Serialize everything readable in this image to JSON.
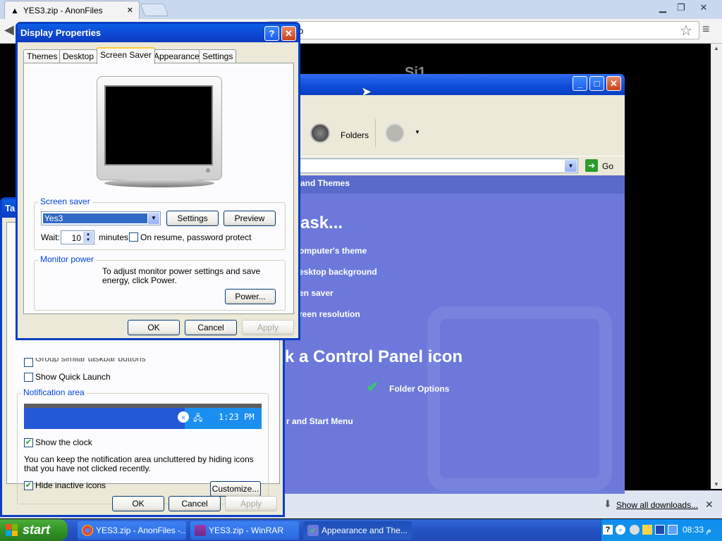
{
  "browser": {
    "tab_title": "YES3.zip - AnonFiles",
    "tab_close": "✕",
    "omnibox_fragment": "o",
    "page_hint": "Si1",
    "downloads": {
      "show_all": "Show all downloads..."
    }
  },
  "control_panel": {
    "toolbar": {
      "folders_label": "Folders"
    },
    "address": {
      "go_label": "Go"
    },
    "category_strip": "and Themes",
    "pick_task": "ask...",
    "tasks": [
      "omputer's theme",
      "esktop background",
      "en saver",
      "reen resolution"
    ],
    "pick_icon": "k a Control Panel icon",
    "icon_item": "Folder Options",
    "footer_link": "r and Start Menu"
  },
  "taskbar_props": {
    "tab_fragment": "Ta",
    "cut_checkbox": "Group similar taskbar buttons",
    "show_quick_launch": "Show Quick Launch",
    "notification_area": {
      "label": "Notification area",
      "preview_time": "1:23 PM",
      "show_clock": "Show the clock",
      "description": "You can keep the notification area uncluttered by hiding icons that you have not clicked recently.",
      "hide_inactive": "Hide inactive icons",
      "customize_button": "Customize..."
    },
    "buttons": {
      "ok": "OK",
      "cancel": "Cancel",
      "apply": "Apply"
    }
  },
  "display_props": {
    "title": "Display Properties",
    "help_btn": "?",
    "close_btn": "✕",
    "tabs": [
      "Themes",
      "Desktop",
      "Screen Saver",
      "Appearance",
      "Settings"
    ],
    "screen_saver": {
      "group_label": "Screen saver",
      "selected": "Yes3",
      "settings_button": "Settings",
      "preview_button": "Preview",
      "wait_label": "Wait:",
      "wait_value": "10",
      "minutes_label": "minutes",
      "password_protect": "On resume, password protect"
    },
    "monitor_power": {
      "group_label": "Monitor power",
      "description": "To adjust monitor power settings and save energy, click Power.",
      "power_button": "Power..."
    },
    "buttons": {
      "ok": "OK",
      "cancel": "Cancel",
      "apply": "Apply"
    }
  },
  "taskbar": {
    "start_label": "start",
    "tasks": [
      {
        "label": "YES3.zip - AnonFiles -...",
        "icon": "chrome-icon"
      },
      {
        "label": "YES3.zip - WinRAR",
        "icon": "winrar-icon"
      },
      {
        "label": "Appearance and The...",
        "icon": "control-panel-icon"
      }
    ],
    "clock": "08:33 م"
  },
  "colors": {
    "xp_blue": "#0a3ec2",
    "xp_face": "#ece9d8",
    "cp_body": "#6c79da",
    "tray": "#1093e8",
    "start_green": "#2f8f23"
  }
}
